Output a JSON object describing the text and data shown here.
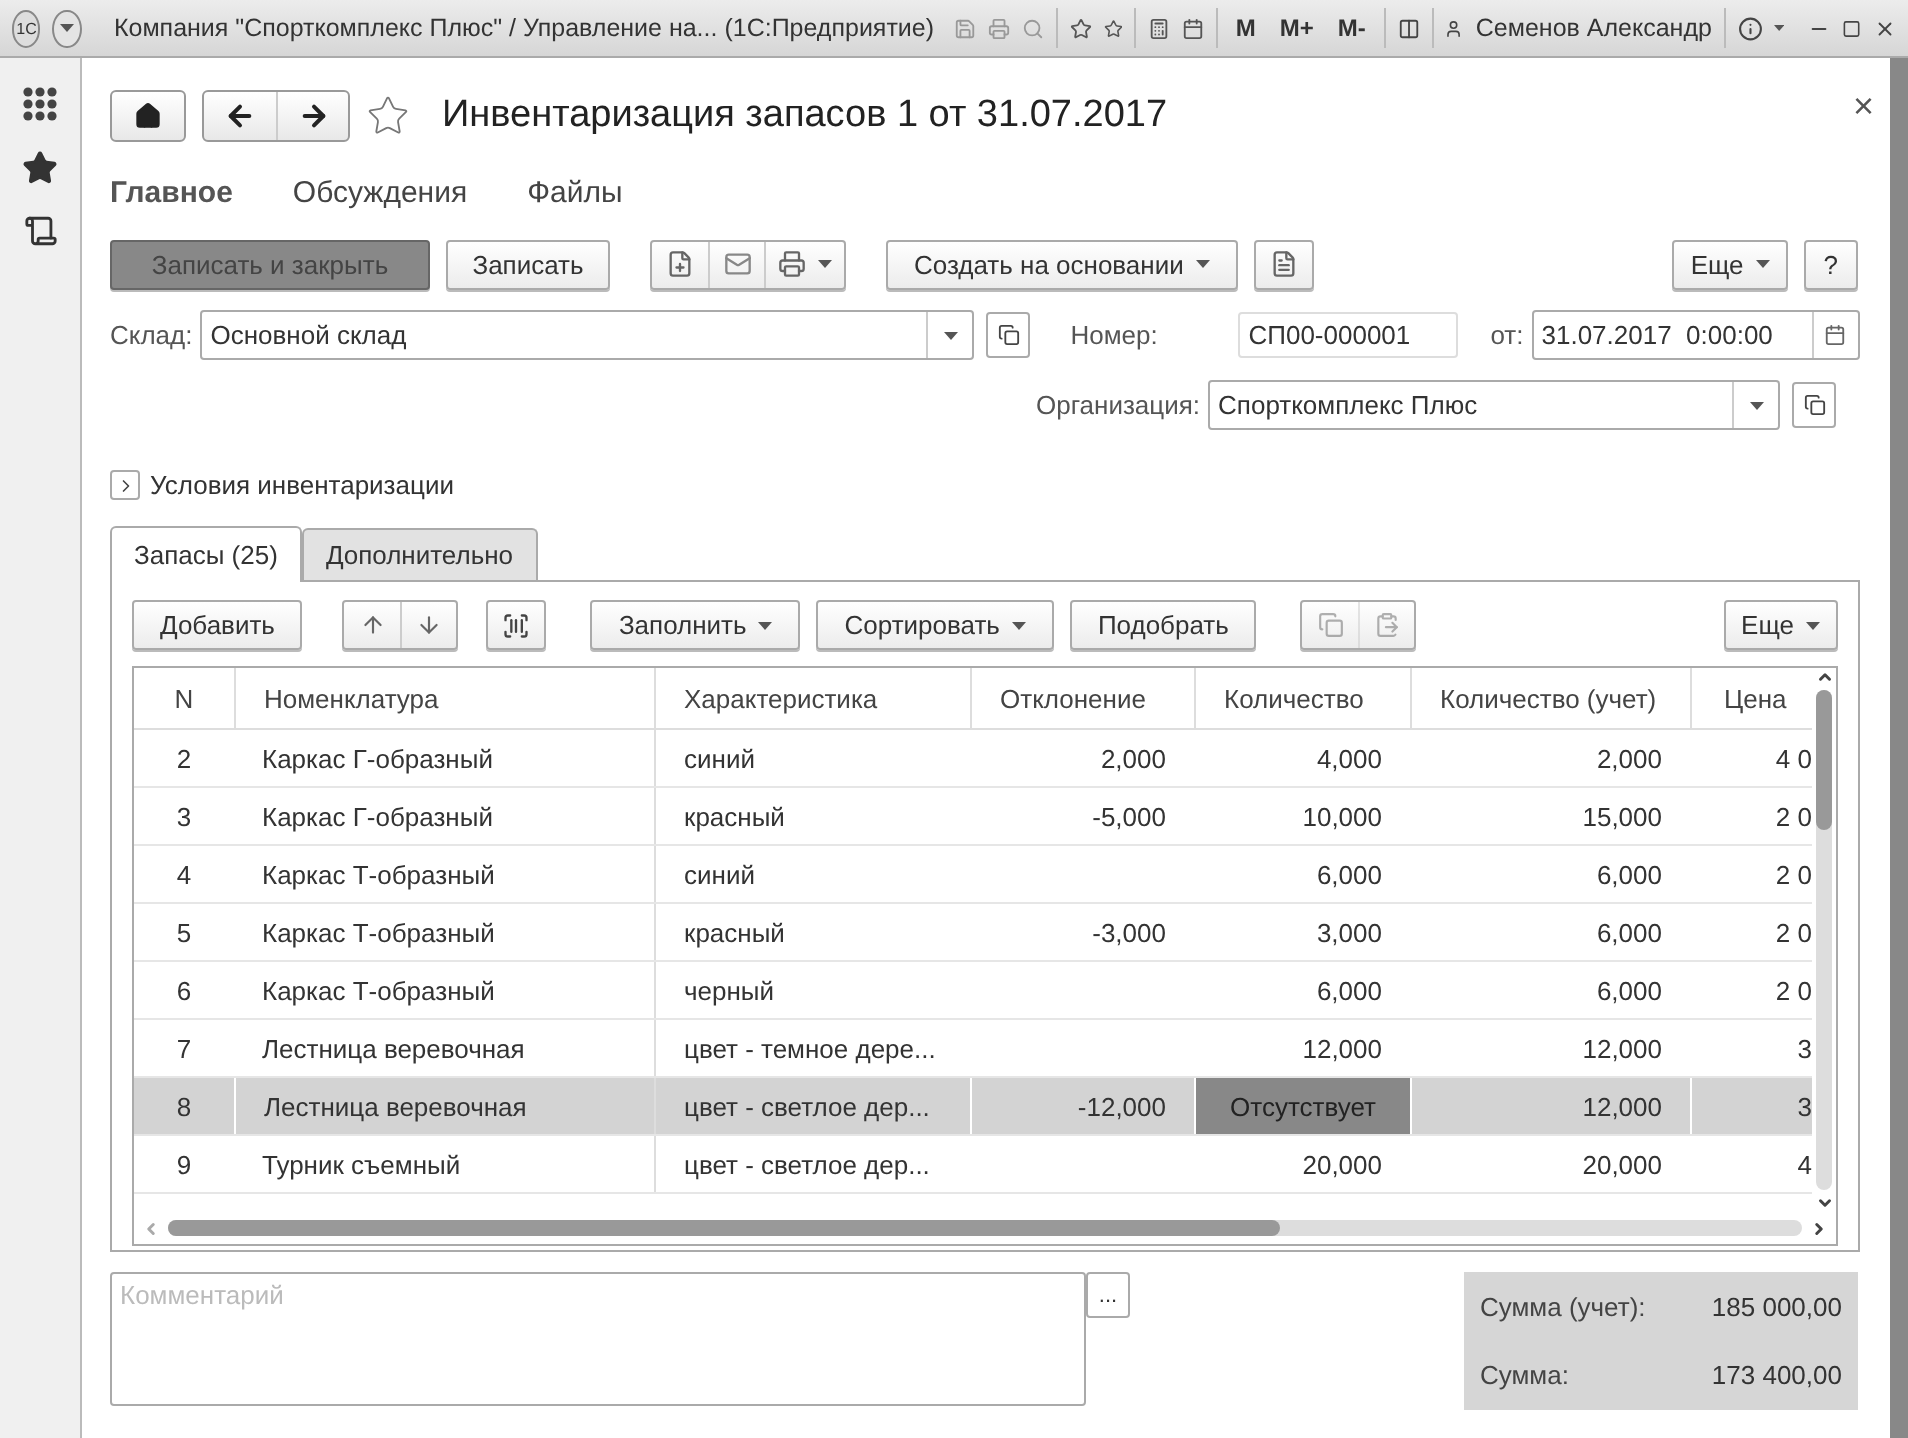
{
  "window": {
    "logo": "1С",
    "title": "Компания \"Спорткомплекс Плюс\" / Управление на... (1С:Предприятие)",
    "memory_buttons": [
      "M",
      "M+",
      "M-"
    ],
    "user": "Семенов Александр"
  },
  "form": {
    "title": "Инвентаризация запасов 1 от 31.07.2017",
    "close": "×"
  },
  "sections": [
    {
      "label": "Главное",
      "selected": true
    },
    {
      "label": "Обсуждения",
      "selected": false
    },
    {
      "label": "Файлы",
      "selected": false
    }
  ],
  "toolbar": {
    "save_close": "Записать и закрыть",
    "save": "Записать",
    "create_based": "Создать на основании",
    "more": "Еще",
    "help": "?"
  },
  "fields": {
    "warehouse": {
      "label": "Склад:",
      "value": "Основной склад"
    },
    "number": {
      "label": "Номер:",
      "value": "СП00-000001"
    },
    "date": {
      "label": "от:",
      "value": "31.07.2017  0:00:00"
    },
    "organization": {
      "label": "Организация:",
      "value": "Спорткомплекс Плюс"
    }
  },
  "conditions_group": {
    "label": "Условия инвентаризации",
    "expanded": false
  },
  "tabs": [
    {
      "label": "Запасы (25)",
      "selected": true
    },
    {
      "label": "Дополнительно",
      "selected": false
    }
  ],
  "table_toolbar": {
    "add": "Добавить",
    "fill": "Заполнить",
    "sort": "Сортировать",
    "pick": "Подобрать",
    "more": "Еще"
  },
  "table": {
    "columns": [
      "N",
      "Номенклатура",
      "Характеристика",
      "Отклонение",
      "Количество",
      "Количество (учет)",
      "Цена"
    ],
    "rows": [
      {
        "n": "2",
        "item": "Каркас Г-образный",
        "characteristic": "синий",
        "deviation": "2,000",
        "quantity": "4,000",
        "quantity_accounted": "2,000",
        "price": "4 0",
        "selected": false,
        "quantity_absent": false
      },
      {
        "n": "3",
        "item": "Каркас Г-образный",
        "characteristic": "красный",
        "deviation": "-5,000",
        "quantity": "10,000",
        "quantity_accounted": "15,000",
        "price": "2 0",
        "selected": false,
        "quantity_absent": false
      },
      {
        "n": "4",
        "item": "Каркас Т-образный",
        "characteristic": "синий",
        "quantity": "6,000",
        "quantity_accounted": "6,000",
        "price": "2 0",
        "selected": false,
        "quantity_absent": false
      },
      {
        "n": "5",
        "item": "Каркас Т-образный",
        "characteristic": "красный",
        "deviation": "-3,000",
        "quantity": "3,000",
        "quantity_accounted": "6,000",
        "price": "2 0",
        "selected": false,
        "quantity_absent": false
      },
      {
        "n": "6",
        "item": "Каркас Т-образный",
        "characteristic": "черный",
        "quantity": "6,000",
        "quantity_accounted": "6,000",
        "price": "2 0",
        "selected": false,
        "quantity_absent": false
      },
      {
        "n": "7",
        "item": "Лестница веревочная",
        "characteristic": "цвет - темное дере...",
        "quantity": "12,000",
        "quantity_accounted": "12,000",
        "price": "3",
        "selected": false,
        "quantity_absent": false
      },
      {
        "n": "8",
        "item": "Лестница веревочная",
        "characteristic": "цвет - светлое дер...",
        "deviation": "-12,000",
        "quantity": "Отсутствует",
        "quantity_accounted": "12,000",
        "price": "3",
        "selected": true,
        "quantity_absent": true
      },
      {
        "n": "9",
        "item": "Турник съемный",
        "characteristic": "цвет - светлое дер...",
        "quantity": "20,000",
        "quantity_accounted": "20,000",
        "price": "4",
        "selected": false,
        "quantity_absent": false
      }
    ]
  },
  "comment": {
    "placeholder": "Комментарий",
    "button": "..."
  },
  "totals": [
    {
      "label": "Сумма (учет):",
      "value": "185 000,00"
    },
    {
      "label": "Сумма:",
      "value": "173 400,00"
    }
  ]
}
